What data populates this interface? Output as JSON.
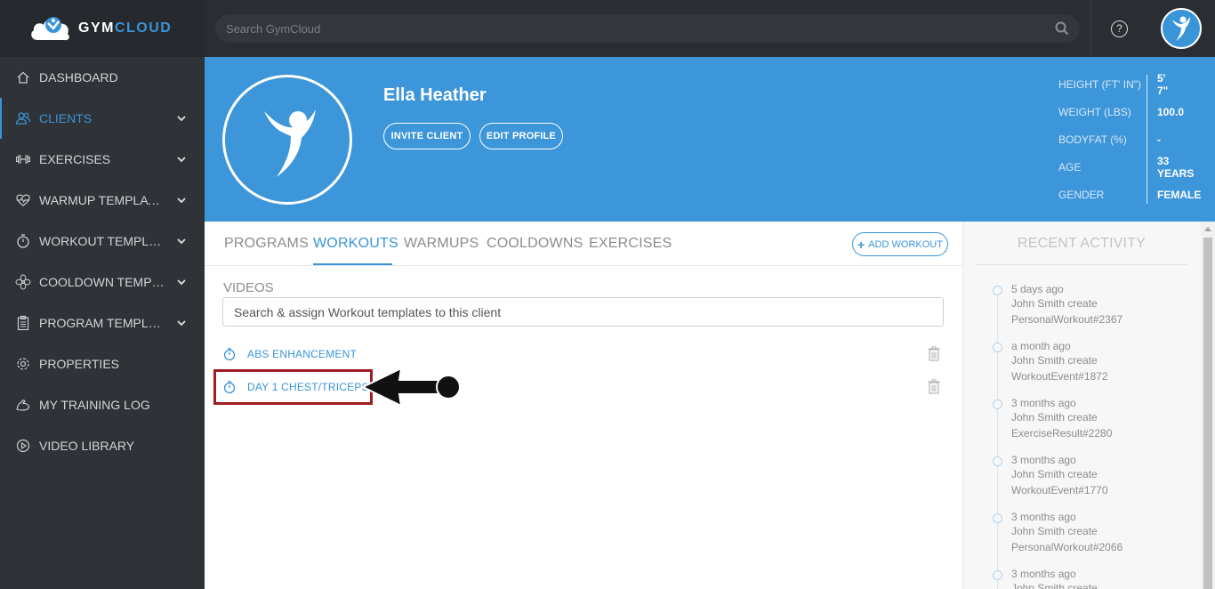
{
  "logo": {
    "part1": "GYM",
    "part2": "CLOUD"
  },
  "search": {
    "placeholder": "Search GymCloud"
  },
  "sidebar": {
    "items": [
      {
        "label": "DASHBOARD",
        "icon": "home-icon",
        "expandable": false,
        "active": false
      },
      {
        "label": "CLIENTS",
        "icon": "users-icon",
        "expandable": true,
        "active": true
      },
      {
        "label": "EXERCISES",
        "icon": "dumbbell-icon",
        "expandable": true,
        "active": false
      },
      {
        "label": "WARMUP TEMPLATES",
        "icon": "heartbeat-icon",
        "expandable": true,
        "active": false
      },
      {
        "label": "WORKOUT TEMPLATES",
        "icon": "stopwatch-icon",
        "expandable": true,
        "active": false
      },
      {
        "label": "COOLDOWN TEMPLATES",
        "icon": "fan-icon",
        "expandable": true,
        "active": false
      },
      {
        "label": "PROGRAM TEMPLATES",
        "icon": "clipboard-icon",
        "expandable": true,
        "active": false
      },
      {
        "label": "PROPERTIES",
        "icon": "gear-icon",
        "expandable": false,
        "active": false
      },
      {
        "label": "MY TRAINING LOG",
        "icon": "muscle-icon",
        "expandable": false,
        "active": false
      },
      {
        "label": "VIDEO LIBRARY",
        "icon": "play-circle-icon",
        "expandable": false,
        "active": false
      }
    ]
  },
  "profile": {
    "name": "Ella Heather",
    "invite_label": "INVITE CLIENT",
    "edit_label": "EDIT PROFILE",
    "stats": [
      {
        "label": "HEIGHT (FT' IN\")",
        "value": "5' 7\""
      },
      {
        "label": "WEIGHT (LBS)",
        "value": "100.0"
      },
      {
        "label": "BODYFAT (%)",
        "value": "-"
      },
      {
        "label": "AGE",
        "value": "33 YEARS"
      },
      {
        "label": "GENDER",
        "value": "FEMALE"
      }
    ]
  },
  "tabs": [
    {
      "label": "PROGRAMS"
    },
    {
      "label": "WORKOUTS"
    },
    {
      "label": "WARMUPS"
    },
    {
      "label": "COOLDOWNS"
    },
    {
      "label": "EXERCISES"
    }
  ],
  "add_workout_label": "ADD WORKOUT",
  "videos_label": "VIDEOS",
  "assign": {
    "placeholder": "Search & assign Workout templates to this client"
  },
  "workouts": [
    {
      "label": "ABS ENHANCEMENT"
    },
    {
      "label": "DAY 1 CHEST/TRICEPS"
    }
  ],
  "activity": {
    "title": "RECENT ACTIVITY",
    "items": [
      {
        "time": "5 days ago",
        "line1": "John Smith create",
        "line2": "PersonalWorkout#2367"
      },
      {
        "time": "a month ago",
        "line1": "John Smith create",
        "line2": "WorkoutEvent#1872"
      },
      {
        "time": "3 months ago",
        "line1": "John Smith create",
        "line2": "ExerciseResult#2280"
      },
      {
        "time": "3 months ago",
        "line1": "John Smith create",
        "line2": "WorkoutEvent#1770"
      },
      {
        "time": "3 months ago",
        "line1": "John Smith create",
        "line2": "PersonalWorkout#2066"
      },
      {
        "time": "3 months ago",
        "line1": "John Smith create",
        "line2": ""
      }
    ]
  },
  "colors": {
    "accent": "#3a94d8",
    "sidebar": "#2f3338",
    "topbar": "#2a2e33",
    "highlight": "#a01c22"
  }
}
